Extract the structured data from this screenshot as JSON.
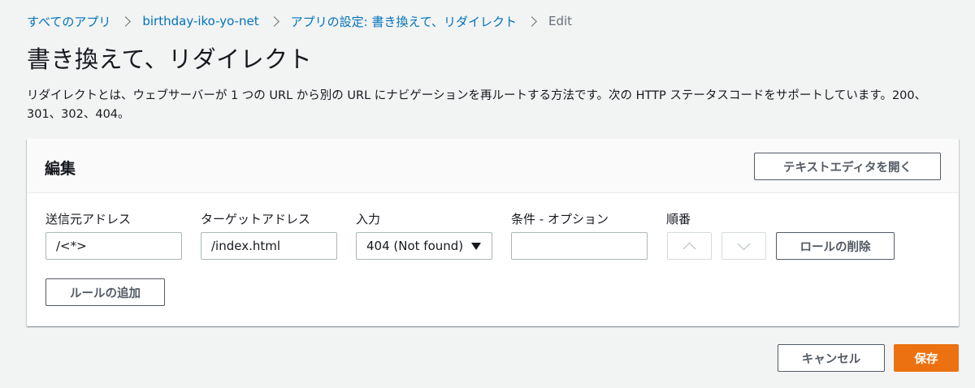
{
  "breadcrumb": {
    "items": [
      "すべてのアプリ",
      "birthday-iko-yo-net",
      "アプリの設定: 書き換えて、リダイレクト"
    ],
    "current": "Edit"
  },
  "page": {
    "title": "書き換えて、リダイレクト",
    "description": "リダイレクトとは、ウェブサーバーが 1 つの URL から別の URL にナビゲーションを再ルートする方法です。次の HTTP ステータスコードをサポートしています。200、301、302、404。"
  },
  "panel": {
    "title": "編集",
    "open_text_editor_label": "テキストエディタを開く",
    "columns": {
      "source": "送信元アドレス",
      "target": "ターゲットアドレス",
      "type": "入力",
      "condition": "条件 - オプション",
      "order": "順番"
    },
    "rule": {
      "source": "/<*>",
      "target": "/index.html",
      "type": "404 (Not found)",
      "condition": ""
    },
    "delete_rule_label": "ロールの削除",
    "add_rule_label": "ルールの追加"
  },
  "footer": {
    "cancel_label": "キャンセル",
    "save_label": "保存"
  },
  "colors": {
    "link": "#0073bb",
    "primary": "#ec7211",
    "background": "#f2f3f3"
  }
}
